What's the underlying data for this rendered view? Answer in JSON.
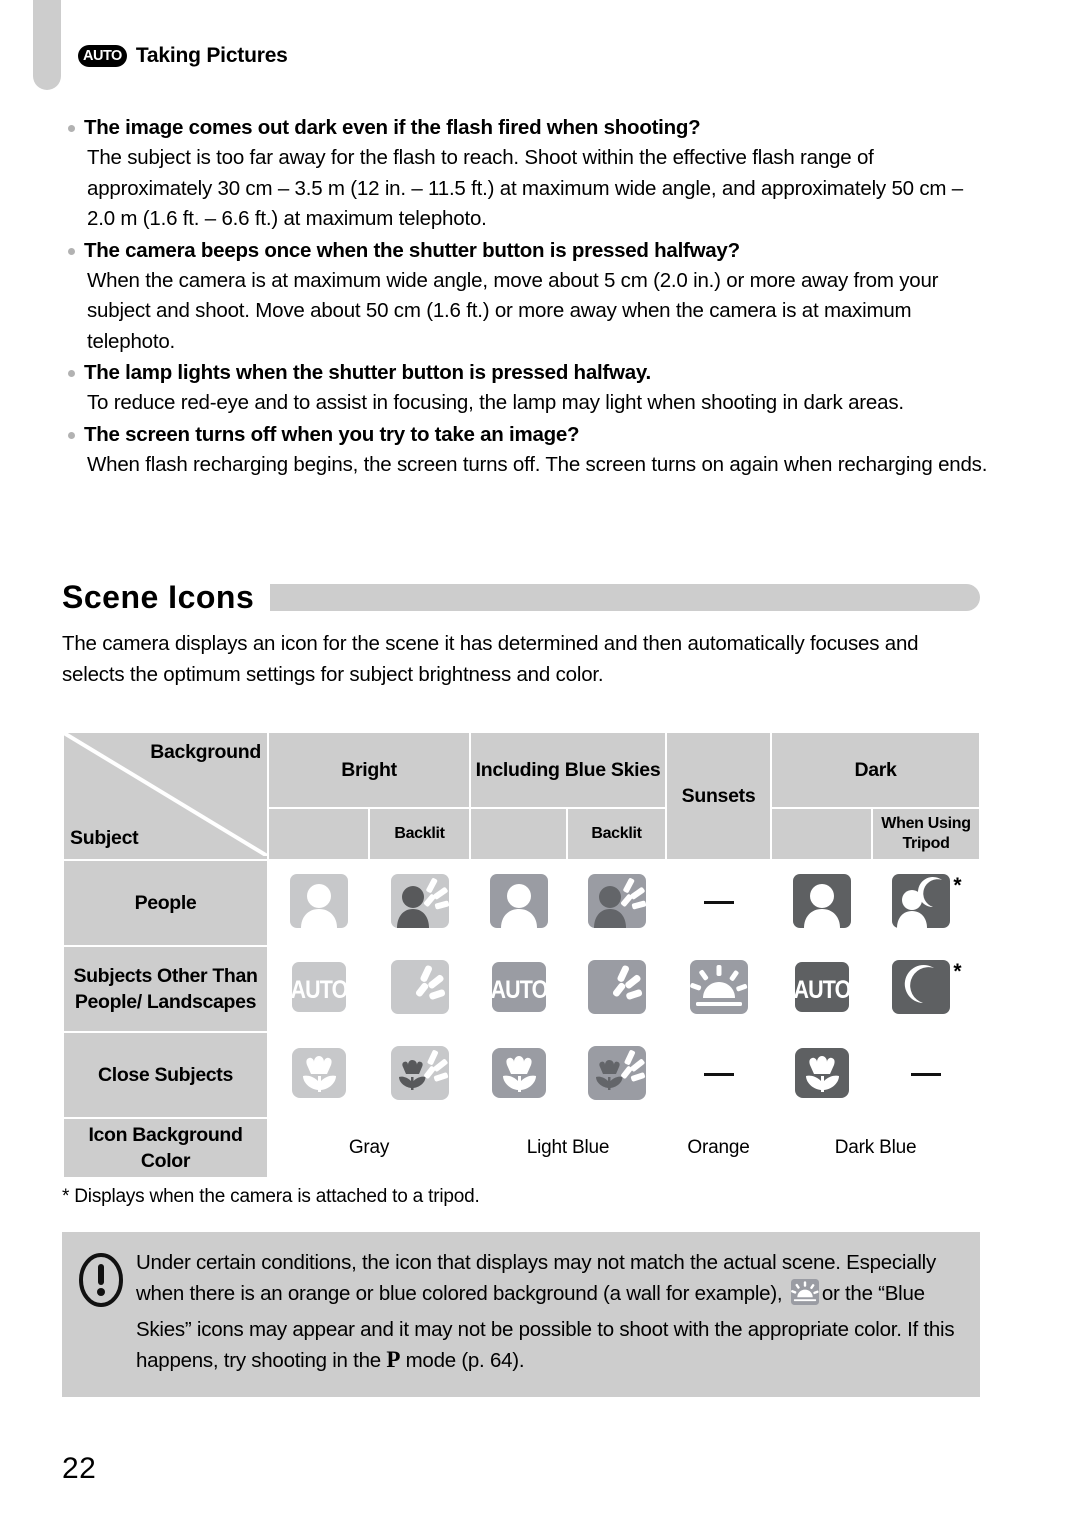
{
  "running_head": {
    "mode_badge": "AUTO",
    "title": "Taking Pictures"
  },
  "faq": [
    {
      "question": "The image comes out dark even if the flash fired when shooting?",
      "answer": "The subject is too far away for the flash to reach. Shoot within the effective flash range of approximately 30 cm – 3.5 m (12 in. – 11.5 ft.) at maximum wide angle, and approximately 50 cm – 2.0 m (1.6 ft. – 6.6 ft.) at maximum telephoto."
    },
    {
      "question": "The camera beeps once when the shutter button is pressed halfway?",
      "answer": "When the camera is at maximum wide angle, move about 5 cm (2.0 in.) or more away from your subject and shoot. Move about 50 cm (1.6 ft.) or more away when the camera is at maximum telephoto."
    },
    {
      "question": "The lamp lights when the shutter button is pressed halfway.",
      "answer": "To reduce red-eye and to assist in focusing, the lamp may light when shooting in dark areas."
    },
    {
      "question": "The screen turns off when you try to take an image?",
      "answer": "When flash recharging begins, the screen turns off. The screen turns on again when recharging ends."
    }
  ],
  "section": {
    "heading": "Scene Icons",
    "intro": "The camera displays an icon for the scene it has determined and then automatically focuses and selects the optimum settings for subject brightness and color."
  },
  "scene_table": {
    "corner": {
      "background_label": "Background",
      "subject_label": "Subject"
    },
    "columns": [
      {
        "group": "Bright",
        "sub": ""
      },
      {
        "group": "Bright",
        "sub": "Backlit"
      },
      {
        "group": "Including Blue Skies",
        "sub": ""
      },
      {
        "group": "Including Blue Skies",
        "sub": "Backlit"
      },
      {
        "group": "Sunsets",
        "sub": ""
      },
      {
        "group": "Dark",
        "sub": ""
      },
      {
        "group": "Dark",
        "sub": "When Using Tripod"
      }
    ],
    "group_headers": [
      {
        "label": "Bright",
        "span": 2
      },
      {
        "label": "Including Blue Skies",
        "span": 2
      },
      {
        "label": "Sunsets",
        "span": 1
      },
      {
        "label": "Dark",
        "span": 2
      }
    ],
    "sub_headers": [
      "",
      "Backlit",
      "",
      "Backlit",
      "",
      "",
      "When Using Tripod"
    ],
    "rows": [
      {
        "label": "People",
        "cells": [
          {
            "icon": "person-icon",
            "bg": "#c7c8ca",
            "fg": "#ffffff",
            "backlit": false,
            "dash": false,
            "star": false
          },
          {
            "icon": "person-backlit-icon",
            "bg": "#c7c8ca",
            "fg": "#58595b",
            "backlit": true,
            "dash": false,
            "star": false
          },
          {
            "icon": "person-icon",
            "bg": "#9a9ca3",
            "fg": "#ffffff",
            "backlit": false,
            "dash": false,
            "star": false
          },
          {
            "icon": "person-backlit-icon",
            "bg": "#9a9ca3",
            "fg": "#636569",
            "backlit": true,
            "dash": false,
            "star": false
          },
          {
            "icon": "",
            "bg": "",
            "fg": "",
            "backlit": false,
            "dash": true,
            "star": false
          },
          {
            "icon": "person-icon",
            "bg": "#5e6062",
            "fg": "#ffffff",
            "backlit": false,
            "dash": false,
            "star": false
          },
          {
            "icon": "person-moon-icon",
            "bg": "#5e6062",
            "fg": "#ffffff",
            "backlit": false,
            "dash": false,
            "star": true
          }
        ]
      },
      {
        "label": "Subjects Other Than People/ Landscapes",
        "cells": [
          {
            "icon": "auto-icon",
            "bg": "#c7c8ca",
            "fg": "#ffffff",
            "backlit": false,
            "dash": false,
            "star": false
          },
          {
            "icon": "backlit-icon",
            "bg": "#c7c8ca",
            "fg": "#ffffff",
            "backlit": true,
            "dash": false,
            "star": false
          },
          {
            "icon": "auto-icon",
            "bg": "#9a9ca3",
            "fg": "#ffffff",
            "backlit": false,
            "dash": false,
            "star": false
          },
          {
            "icon": "backlit-icon",
            "bg": "#9a9ca3",
            "fg": "#ffffff",
            "backlit": true,
            "dash": false,
            "star": false
          },
          {
            "icon": "sunset-icon",
            "bg": "#9a9ca3",
            "fg": "#ffffff",
            "backlit": false,
            "dash": false,
            "star": false
          },
          {
            "icon": "auto-icon",
            "bg": "#5e6062",
            "fg": "#ffffff",
            "backlit": false,
            "dash": false,
            "star": false
          },
          {
            "icon": "moon-icon",
            "bg": "#5e6062",
            "fg": "#ffffff",
            "backlit": false,
            "dash": false,
            "star": true
          }
        ]
      },
      {
        "label": "Close Subjects",
        "cells": [
          {
            "icon": "flower-icon",
            "bg": "#c7c8ca",
            "fg": "#ffffff",
            "backlit": false,
            "dash": false,
            "star": false
          },
          {
            "icon": "flower-backlit-icon",
            "bg": "#c7c8ca",
            "fg": "#58595b",
            "backlit": true,
            "dash": false,
            "star": false
          },
          {
            "icon": "flower-icon",
            "bg": "#9a9ca3",
            "fg": "#ffffff",
            "backlit": false,
            "dash": false,
            "star": false
          },
          {
            "icon": "flower-backlit-icon",
            "bg": "#9a9ca3",
            "fg": "#636569",
            "backlit": true,
            "dash": false,
            "star": false
          },
          {
            "icon": "",
            "bg": "",
            "fg": "",
            "backlit": false,
            "dash": true,
            "star": false
          },
          {
            "icon": "flower-icon",
            "bg": "#5e6062",
            "fg": "#ffffff",
            "backlit": false,
            "dash": false,
            "star": false
          },
          {
            "icon": "",
            "bg": "",
            "fg": "",
            "backlit": false,
            "dash": true,
            "star": false
          }
        ]
      }
    ],
    "color_row": {
      "label": "Icon Background Color",
      "values": [
        {
          "text": "Gray",
          "span": 2
        },
        {
          "text": "Light Blue",
          "span": 2
        },
        {
          "text": "Orange",
          "span": 1
        },
        {
          "text": "Dark Blue",
          "span": 2
        }
      ]
    }
  },
  "footnote": "* Displays when the camera is attached to a tripod.",
  "caution": {
    "text_part1": "Under certain conditions, the icon that displays may not match the actual scene. Especially when there is an orange or blue colored background (a wall for example),",
    "text_part2": "or the “Blue Skies” icons may appear and it may not be possible to shoot with the appropriate color. If this happens, try shooting in the",
    "mode_letter": "P",
    "text_part3": "mode (p. 64)."
  },
  "page_number": "22",
  "colors": {
    "gray_fill": "#cdcdcd",
    "icon_light": "#c7c8ca",
    "icon_mid": "#9a9ca3",
    "icon_dark": "#5e6062"
  }
}
